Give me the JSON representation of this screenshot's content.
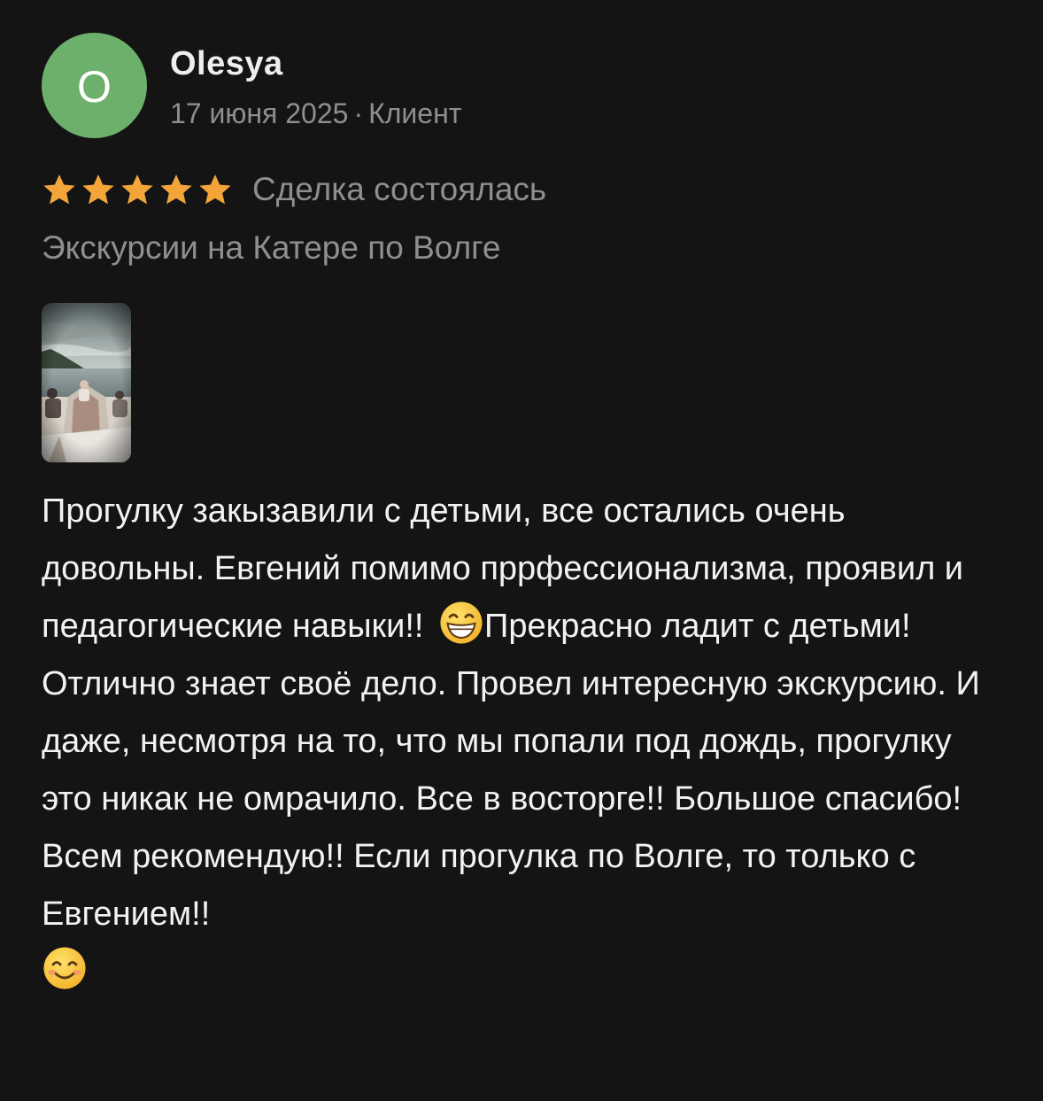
{
  "review": {
    "author": {
      "initial": "O",
      "name": "Olesya",
      "avatar_color": "#6db06c"
    },
    "date": "17 июня 2025",
    "separator": "·",
    "role": "Клиент",
    "rating": 5,
    "star_color": "#f3a53a",
    "status": "Сделка состоялась",
    "service": "Экскурсии на Катере по Волге",
    "photo": {
      "icon": "boat-trip-photo-thumbnail"
    },
    "text_parts": [
      "Прогулку закызавили с детьми, все остались очень довольны. Евгений помимо пррфессионализма, проявил и педагогические навыки!! ",
      "Прекрасно ладит с детьми! Отлично знает своё дело. Провел интересную экскурсию. И даже, несмотря на то, что мы попали под дождь, прогулку это никак не омрачило. Все в восторге!! Большое спасибо! Всем рекомендую!! Если прогулка по Волге, то только с Евгением!! "
    ],
    "emojis": [
      "grinning-face-emoji",
      "smiling-face-emoji"
    ]
  }
}
